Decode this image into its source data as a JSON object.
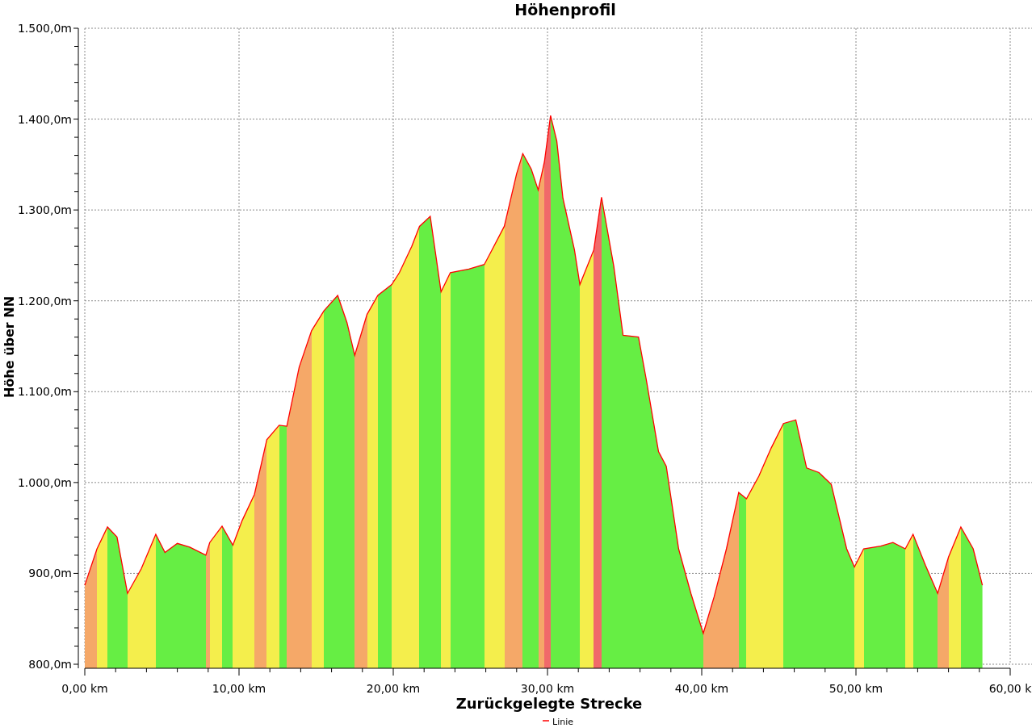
{
  "chart": {
    "chart_data": {
      "type": "area",
      "title": "Höhenprofil",
      "xlabel": "Zurückgelegte Strecke",
      "ylabel": "Höhe über NN",
      "x": [
        0,
        0.79,
        1.47,
        2.09,
        2.77,
        3.66,
        4.6,
        5.2,
        6.0,
        6.8,
        7.85,
        8.1,
        8.9,
        9.6,
        10.2,
        11.0,
        11.8,
        12.6,
        13.1,
        13.9,
        14.7,
        15.5,
        16.4,
        17.0,
        17.5,
        18.3,
        19.0,
        19.9,
        20.4,
        21.2,
        21.7,
        22.4,
        23.1,
        23.7,
        24.9,
        25.9,
        26.4,
        27.2,
        28.0,
        28.4,
        28.95,
        29.4,
        29.8,
        30.2,
        30.6,
        31.0,
        31.75,
        32.1,
        33.0,
        33.5,
        34.3,
        34.9,
        35.9,
        36.4,
        37.2,
        37.7,
        38.5,
        39.3,
        40.1,
        40.8,
        41.6,
        42.4,
        42.9,
        43.7,
        44.5,
        45.3,
        46.1,
        46.8,
        47.6,
        48.4,
        49.4,
        49.9,
        50.5,
        51.6,
        52.4,
        53.2,
        53.7,
        54.5,
        55.3,
        56.0,
        56.8,
        57.6,
        58.2
      ],
      "series": [
        {
          "name": "Linie",
          "color": "#ff0000",
          "values": [
            887,
            927,
            951,
            940,
            878,
            905,
            943,
            923,
            933,
            929,
            920,
            934,
            952,
            931,
            958,
            987,
            1047,
            1063,
            1062,
            1127,
            1167,
            1189,
            1206,
            1176,
            1140,
            1185,
            1206,
            1218,
            1231,
            1260,
            1282,
            1293,
            1210,
            1231,
            1235,
            1240,
            1256,
            1282,
            1340,
            1362,
            1345,
            1322,
            1353,
            1404,
            1376,
            1313,
            1256,
            1218,
            1256,
            1314,
            1238,
            1162,
            1160,
            1114,
            1034,
            1018,
            927,
            878,
            834,
            874,
            927,
            989,
            982,
            1007,
            1038,
            1065,
            1069,
            1016,
            1011,
            998,
            927,
            907,
            927,
            930,
            934,
            927,
            943,
            909,
            878,
            918,
            951,
            927,
            887
          ]
        }
      ],
      "xlim": [
        0,
        60
      ],
      "ylim": [
        800,
        1500
      ],
      "xticks": [
        {
          "value": 0,
          "label": "0,00 km"
        },
        {
          "value": 10,
          "label": "10,00 km"
        },
        {
          "value": 20,
          "label": "20,00 km"
        },
        {
          "value": 30,
          "label": "30,00 km"
        },
        {
          "value": 40,
          "label": "40,00 km"
        },
        {
          "value": 50,
          "label": "50,00 km"
        },
        {
          "value": 60,
          "label": "60,00 k"
        }
      ],
      "grid": true,
      "yticks": [
        {
          "value": 800,
          "label": "800,0m"
        },
        {
          "value": 900,
          "label": "900,0m"
        },
        {
          "value": 1000,
          "label": "1.000,0m"
        },
        {
          "value": 1100,
          "label": "1.100,0m"
        },
        {
          "value": 1200,
          "label": "1.200,0m"
        },
        {
          "value": 1300,
          "label": "1.300,0m"
        },
        {
          "value": 1400,
          "label": "1.400,0m"
        },
        {
          "value": 1500,
          "label": "1.500,0m"
        }
      ]
    }
  }
}
